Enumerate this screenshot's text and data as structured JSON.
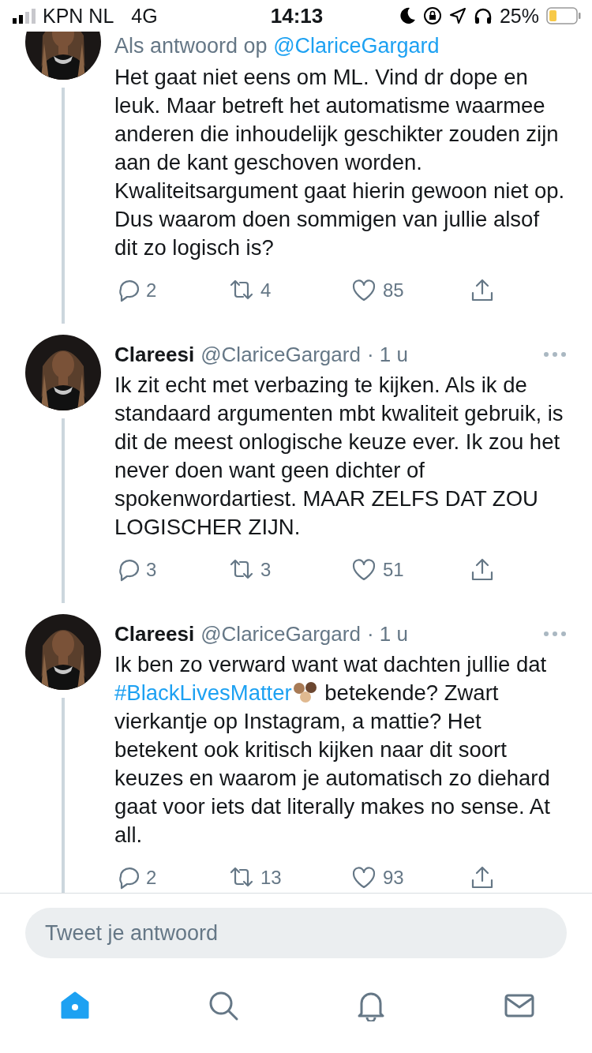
{
  "status_bar": {
    "carrier": "KPN NL",
    "network": "4G",
    "time": "14:13",
    "battery": "25%"
  },
  "tweets": [
    {
      "reply_to": {
        "prefix": "Als antwoord op",
        "handle": "@ClariceGargard"
      },
      "body": [
        {
          "kind": "text",
          "text": "Het gaat niet eens om ML. Vind dr dope en leuk. Maar betreft het automatisme waarmee anderen die inhoudelijk geschikter zouden zijn aan de kant geschoven worden. Kwaliteitsargument gaat hierin gewoon niet op. Dus waarom doen sommigen van jullie alsof dit zo logisch is?"
        }
      ],
      "actions": {
        "replies": "2",
        "retweets": "4",
        "likes": "85"
      }
    },
    {
      "name": "Clareesi",
      "handle": "@ClariceGargard",
      "time": "· 1 u",
      "body": [
        {
          "kind": "text",
          "text": "Ik zit echt met verbazing te kijken. Als ik de standaard argumenten mbt kwaliteit gebruik, is dit de meest onlogische keuze ever. Ik zou het never doen want geen dichter of spokenwordartiest. MAAR ZELFS DAT ZOU LOGISCHER ZIJN."
        }
      ],
      "actions": {
        "replies": "3",
        "retweets": "3",
        "likes": "51"
      }
    },
    {
      "name": "Clareesi",
      "handle": "@ClariceGargard",
      "time": "· 1 u",
      "body": [
        {
          "kind": "text",
          "text": "Ik ben zo verward want wat dachten jullie dat "
        },
        {
          "kind": "link",
          "text": "#BlackLivesMatter"
        },
        {
          "kind": "emoji"
        },
        {
          "kind": "text",
          "text": " betekende? Zwart vierkantje op Instagram, a mattie? Het betekent ook kritisch kijken naar dit soort keuzes en waarom je automatisch zo diehard gaat voor iets dat literally makes no sense. At all."
        }
      ],
      "actions": {
        "replies": "2",
        "retweets": "13",
        "likes": "93"
      }
    }
  ],
  "reply_field": {
    "placeholder": "Tweet je antwoord"
  },
  "tab_bar": [
    {
      "kind": "home",
      "selected": true
    },
    {
      "kind": "search",
      "selected": false
    },
    {
      "kind": "notifications",
      "selected": false
    },
    {
      "kind": "messages",
      "selected": false
    }
  ]
}
